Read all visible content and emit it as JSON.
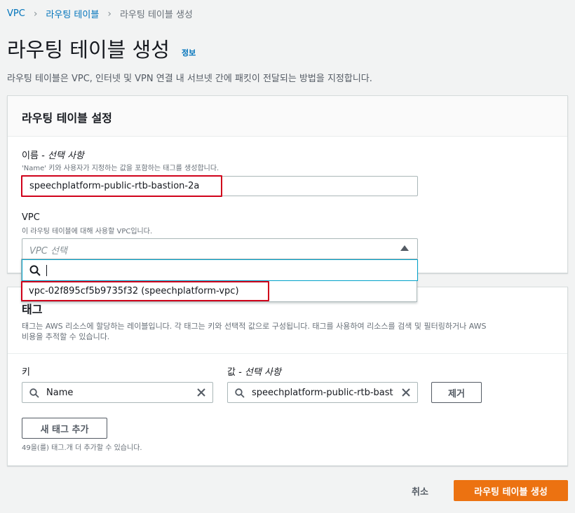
{
  "breadcrumb": {
    "items": [
      "VPC",
      "라우팅 테이블",
      "라우팅 테이블 생성"
    ]
  },
  "header": {
    "title": "라우팅 테이블 생성",
    "info_link": "정보",
    "description": "라우팅 테이블은 VPC, 인터넷 및 VPN 연결 내 서브넷 간에 패킷이 전달되는 방법을 지정합니다."
  },
  "settings": {
    "title": "라우팅 테이블 설정",
    "name_label": "이름",
    "name_optional": "- 선택 사항",
    "name_hint": "'Name' 키와 사용자가 지정하는 값을 포함하는 태그를 생성합니다.",
    "name_value": "speechplatform-public-rtb-bastion-2a",
    "vpc_label": "VPC",
    "vpc_hint": "이 라우팅 테이블에 대해 사용할 VPC입니다.",
    "vpc_placeholder": "VPC 선택",
    "vpc_search_value": "",
    "vpc_options": [
      "vpc-02f895cf5b9735f32 (speechplatform-vpc)"
    ]
  },
  "tags": {
    "title": "태그",
    "description_line1": "태그는 AWS 리소스에 할당하는 레이블입니다. 각 태그는 키와 선택적 값으로 구성됩니다. 태그를 사용하여 리소스를 검색 및 필터링하거나 AWS",
    "description_line2": "비용을 추적할 수 있습니다.",
    "key_label": "키",
    "value_label": "값",
    "value_optional": "- 선택 사항",
    "key_value": "Name",
    "value_value": "speechplatform-public-rtb-bast",
    "remove_label": "제거",
    "add_label": "새 태그 추가",
    "remaining": "49을(를) 태그.개 더 추가할 수 있습니다."
  },
  "footer": {
    "cancel_label": "취소",
    "submit_label": "라우팅 테이블 생성"
  },
  "colors": {
    "link": "#0073bb",
    "primary": "#ec7211",
    "highlight": "#d0021b",
    "focus": "#00a1c9"
  }
}
